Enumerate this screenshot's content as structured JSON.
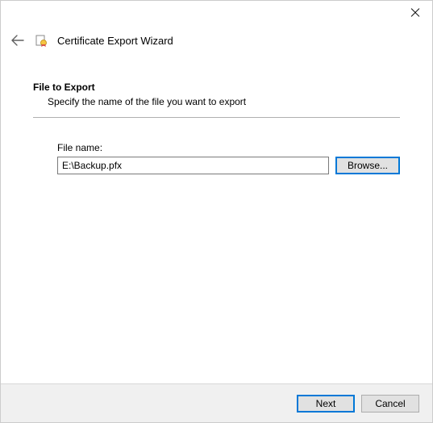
{
  "window": {
    "title": "Certificate Export Wizard"
  },
  "page": {
    "heading": "File to Export",
    "description": "Specify the name of the file you want to export"
  },
  "form": {
    "file_label": "File name:",
    "file_value": "E:\\Backup.pfx",
    "browse_label": "Browse..."
  },
  "footer": {
    "next": "Next",
    "cancel": "Cancel"
  }
}
